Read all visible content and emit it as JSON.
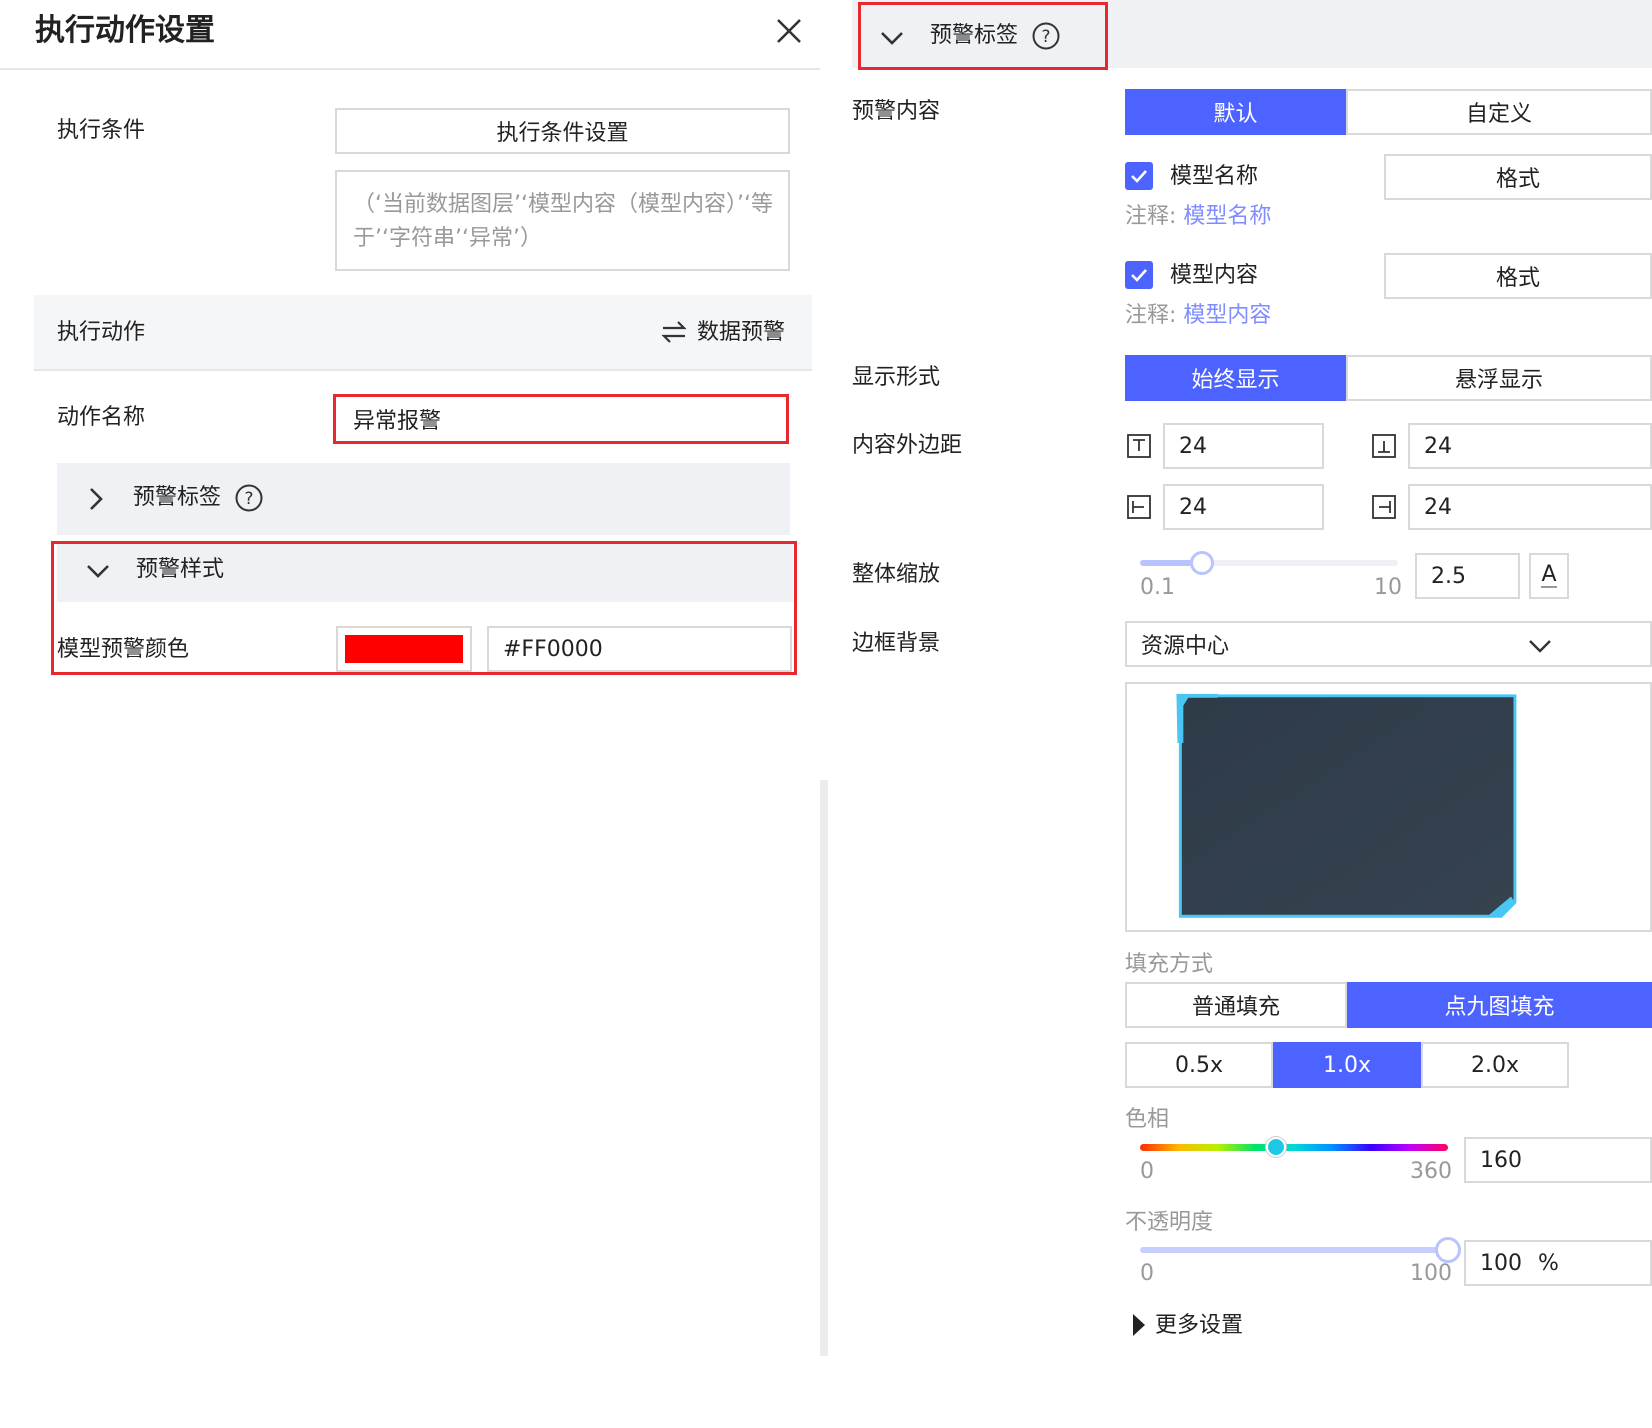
{
  "left": {
    "title": "执行动作设置",
    "condition_label": "执行条件",
    "condition_button": "执行条件设置",
    "condition_text": "（‘当前数据图层’‘模型内容（模型内容）’‘等于’‘字符串’‘异常’）",
    "action_label": "执行动作",
    "action_type": "数据预警",
    "action_name_label": "动作名称",
    "action_name_value": "异常报警",
    "warning_label_section": "预警标签",
    "warning_style_section": "预警样式",
    "model_color_label": "模型预警颜色",
    "model_color_value": "#FF0000",
    "model_color_swatch": "#FF0000"
  },
  "right": {
    "section_title": "预警标签",
    "content_label": "预警内容",
    "content_options": [
      "默认",
      "自定义"
    ],
    "items": [
      {
        "name": "模型名称",
        "format": "格式",
        "note_prefix": "注释:",
        "note": "模型名称",
        "checked": true
      },
      {
        "name": "模型内容",
        "format": "格式",
        "note_prefix": "注释:",
        "note": "模型内容",
        "checked": true
      }
    ],
    "display_label": "显示形式",
    "display_options": [
      "始终显示",
      "悬浮显示"
    ],
    "padding_label": "内容外边距",
    "padding_values": [
      "24",
      "24",
      "24",
      "24"
    ],
    "scale_label": "整体缩放",
    "scale_min": "0.1",
    "scale_max": "10",
    "scale_value": "2.5",
    "border_label": "边框背景",
    "border_select": "资源中心",
    "fill_label": "填充方式",
    "fill_options": [
      "普通填充",
      "点九图填充"
    ],
    "zoom_options": [
      "0.5x",
      "1.0x",
      "2.0x"
    ],
    "hue_label": "色相",
    "hue_min": "0",
    "hue_max": "360",
    "hue_value": "160",
    "opacity_label": "不透明度",
    "opacity_min": "0",
    "opacity_max": "100",
    "opacity_value": "100",
    "opacity_unit": "%",
    "more_settings": "更多设置"
  },
  "colors": {
    "accent": "#4d63ff",
    "highlight": "#e8282f",
    "panel_bg": "#f0f1f4"
  }
}
